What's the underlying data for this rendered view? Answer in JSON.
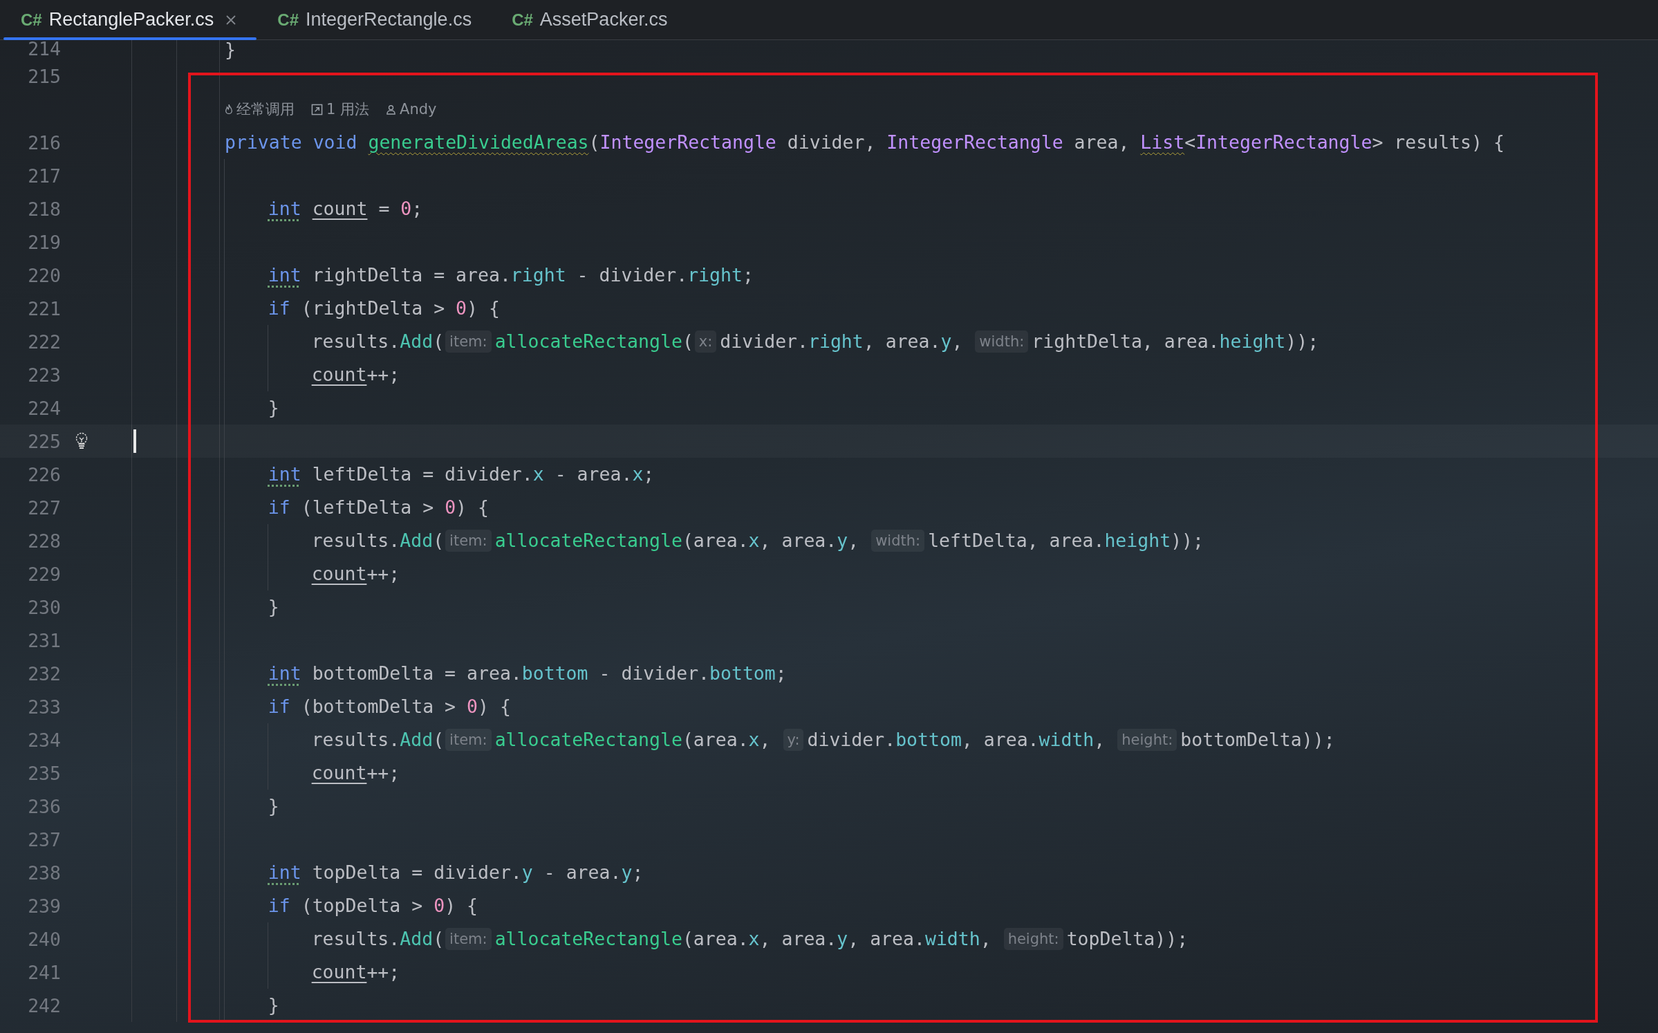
{
  "tabs": [
    {
      "badge": "C#",
      "label": "RectanglePacker.cs",
      "selected": true,
      "closable": true
    },
    {
      "badge": "C#",
      "label": "IntegerRectangle.cs",
      "selected": false,
      "closable": false
    },
    {
      "badge": "C#",
      "label": "AssetPacker.cs",
      "selected": false,
      "closable": false
    }
  ],
  "code_lens": [
    {
      "text": "经常调用"
    },
    {
      "text": "1 用法"
    },
    {
      "text": "Andy"
    }
  ],
  "lines": [
    {
      "number": "214",
      "tokens": [
        {
          "text": "}",
          "kind": "plain"
        }
      ]
    },
    {
      "number": "215"
    },
    {
      "kind": "code_lens"
    },
    {
      "number": "216",
      "tokens": [
        {
          "text": "private",
          "kind": "keyword"
        },
        {
          "text": " void",
          "kind": "keyword"
        },
        {
          "text": " generateDividedAreas",
          "kind": "function",
          "typo": true
        },
        {
          "text": "(",
          "kind": "plain"
        },
        {
          "text": "IntegerRectangle",
          "kind": "type"
        },
        {
          "text": " divider, ",
          "kind": "plain"
        },
        {
          "text": "IntegerRectangle",
          "kind": "type"
        },
        {
          "text": " area, ",
          "kind": "plain"
        },
        {
          "text": "List",
          "kind": "type",
          "typo": true
        },
        {
          "text": "<",
          "kind": "plain"
        },
        {
          "text": "IntegerRectangle",
          "kind": "type"
        },
        {
          "text": "> results) {",
          "kind": "plain"
        }
      ]
    },
    {
      "number": "217"
    },
    {
      "number": "218",
      "tokens": [
        {
          "text": "    int",
          "kind": "keyword",
          "weak_warning": true
        },
        {
          "text": " count",
          "kind": "plain",
          "mutable": true
        },
        {
          "text": " = ",
          "kind": "plain"
        },
        {
          "text": "0",
          "kind": "number"
        },
        {
          "text": ";",
          "kind": "plain"
        }
      ]
    },
    {
      "number": "219"
    },
    {
      "number": "220",
      "tokens": [
        {
          "text": "    int",
          "kind": "keyword",
          "weak_warning": true
        },
        {
          "text": " rightDelta = area.",
          "kind": "plain"
        },
        {
          "text": "right",
          "kind": "field"
        },
        {
          "text": " - divider.",
          "kind": "plain"
        },
        {
          "text": "right",
          "kind": "field"
        },
        {
          "text": ";",
          "kind": "plain"
        }
      ]
    },
    {
      "number": "221",
      "tokens": [
        {
          "text": "    if",
          "kind": "keyword"
        },
        {
          "text": " (rightDelta > ",
          "kind": "plain"
        },
        {
          "text": "0",
          "kind": "number"
        },
        {
          "text": ") {",
          "kind": "plain"
        }
      ]
    },
    {
      "number": "222",
      "tokens": [
        {
          "text": "        results.",
          "kind": "plain"
        },
        {
          "text": "Add",
          "kind": "method"
        },
        {
          "text": "(",
          "kind": "plain"
        },
        {
          "text": "item:",
          "kind": "hint"
        },
        {
          "text": "allocateRectangle",
          "kind": "function"
        },
        {
          "text": "(",
          "kind": "plain"
        },
        {
          "text": "x:",
          "kind": "hint"
        },
        {
          "text": "divider.",
          "kind": "plain"
        },
        {
          "text": "right",
          "kind": "field"
        },
        {
          "text": ", area.",
          "kind": "plain"
        },
        {
          "text": "y",
          "kind": "field"
        },
        {
          "text": ", ",
          "kind": "plain"
        },
        {
          "text": "width:",
          "kind": "hint"
        },
        {
          "text": "rightDelta, area.",
          "kind": "plain"
        },
        {
          "text": "height",
          "kind": "field"
        },
        {
          "text": "));",
          "kind": "plain"
        }
      ]
    },
    {
      "number": "223",
      "tokens": [
        {
          "text": "        count",
          "kind": "plain",
          "mutable": true
        },
        {
          "text": "++;",
          "kind": "plain"
        }
      ]
    },
    {
      "number": "224",
      "tokens": [
        {
          "text": "    }",
          "kind": "plain"
        }
      ]
    },
    {
      "number": "225",
      "current": true,
      "intention": true
    },
    {
      "number": "226",
      "tokens": [
        {
          "text": "    int",
          "kind": "keyword",
          "weak_warning": true
        },
        {
          "text": " leftDelta = divider.",
          "kind": "plain"
        },
        {
          "text": "x",
          "kind": "field"
        },
        {
          "text": " - area.",
          "kind": "plain"
        },
        {
          "text": "x",
          "kind": "field"
        },
        {
          "text": ";",
          "kind": "plain"
        }
      ]
    },
    {
      "number": "227",
      "tokens": [
        {
          "text": "    if",
          "kind": "keyword"
        },
        {
          "text": " (leftDelta > ",
          "kind": "plain"
        },
        {
          "text": "0",
          "kind": "number"
        },
        {
          "text": ") {",
          "kind": "plain"
        }
      ]
    },
    {
      "number": "228",
      "tokens": [
        {
          "text": "        results.",
          "kind": "plain"
        },
        {
          "text": "Add",
          "kind": "method"
        },
        {
          "text": "(",
          "kind": "plain"
        },
        {
          "text": "item:",
          "kind": "hint"
        },
        {
          "text": "allocateRectangle",
          "kind": "function"
        },
        {
          "text": "(area.",
          "kind": "plain"
        },
        {
          "text": "x",
          "kind": "field"
        },
        {
          "text": ", area.",
          "kind": "plain"
        },
        {
          "text": "y",
          "kind": "field"
        },
        {
          "text": ", ",
          "kind": "plain"
        },
        {
          "text": "width:",
          "kind": "hint"
        },
        {
          "text": "leftDelta, area.",
          "kind": "plain"
        },
        {
          "text": "height",
          "kind": "field"
        },
        {
          "text": "));",
          "kind": "plain"
        }
      ]
    },
    {
      "number": "229",
      "tokens": [
        {
          "text": "        count",
          "kind": "plain",
          "mutable": true
        },
        {
          "text": "++;",
          "kind": "plain"
        }
      ]
    },
    {
      "number": "230",
      "tokens": [
        {
          "text": "    }",
          "kind": "plain"
        }
      ]
    },
    {
      "number": "231"
    },
    {
      "number": "232",
      "tokens": [
        {
          "text": "    int",
          "kind": "keyword",
          "weak_warning": true
        },
        {
          "text": " bottomDelta = area.",
          "kind": "plain"
        },
        {
          "text": "bottom",
          "kind": "field"
        },
        {
          "text": " - divider.",
          "kind": "plain"
        },
        {
          "text": "bottom",
          "kind": "field"
        },
        {
          "text": ";",
          "kind": "plain"
        }
      ]
    },
    {
      "number": "233",
      "tokens": [
        {
          "text": "    if",
          "kind": "keyword"
        },
        {
          "text": " (bottomDelta > ",
          "kind": "plain"
        },
        {
          "text": "0",
          "kind": "number"
        },
        {
          "text": ") {",
          "kind": "plain"
        }
      ]
    },
    {
      "number": "234",
      "tokens": [
        {
          "text": "        results.",
          "kind": "plain"
        },
        {
          "text": "Add",
          "kind": "method"
        },
        {
          "text": "(",
          "kind": "plain"
        },
        {
          "text": "item:",
          "kind": "hint"
        },
        {
          "text": "allocateRectangle",
          "kind": "function"
        },
        {
          "text": "(area.",
          "kind": "plain"
        },
        {
          "text": "x",
          "kind": "field"
        },
        {
          "text": ", ",
          "kind": "plain"
        },
        {
          "text": "y:",
          "kind": "hint"
        },
        {
          "text": "divider.",
          "kind": "plain"
        },
        {
          "text": "bottom",
          "kind": "field"
        },
        {
          "text": ", area.",
          "kind": "plain"
        },
        {
          "text": "width",
          "kind": "field"
        },
        {
          "text": ", ",
          "kind": "plain"
        },
        {
          "text": "height:",
          "kind": "hint"
        },
        {
          "text": "bottomDelta));",
          "kind": "plain"
        }
      ]
    },
    {
      "number": "235",
      "tokens": [
        {
          "text": "        count",
          "kind": "plain",
          "mutable": true
        },
        {
          "text": "++;",
          "kind": "plain"
        }
      ]
    },
    {
      "number": "236",
      "tokens": [
        {
          "text": "    }",
          "kind": "plain"
        }
      ]
    },
    {
      "number": "237"
    },
    {
      "number": "238",
      "tokens": [
        {
          "text": "    int",
          "kind": "keyword",
          "weak_warning": true
        },
        {
          "text": " topDelta = divider.",
          "kind": "plain"
        },
        {
          "text": "y",
          "kind": "field"
        },
        {
          "text": " - area.",
          "kind": "plain"
        },
        {
          "text": "y",
          "kind": "field"
        },
        {
          "text": ";",
          "kind": "plain"
        }
      ]
    },
    {
      "number": "239",
      "tokens": [
        {
          "text": "    if",
          "kind": "keyword"
        },
        {
          "text": " (topDelta > ",
          "kind": "plain"
        },
        {
          "text": "0",
          "kind": "number"
        },
        {
          "text": ") {",
          "kind": "plain"
        }
      ]
    },
    {
      "number": "240",
      "tokens": [
        {
          "text": "        results.",
          "kind": "plain"
        },
        {
          "text": "Add",
          "kind": "method"
        },
        {
          "text": "(",
          "kind": "plain"
        },
        {
          "text": "item:",
          "kind": "hint"
        },
        {
          "text": "allocateRectangle",
          "kind": "function"
        },
        {
          "text": "(area.",
          "kind": "plain"
        },
        {
          "text": "x",
          "kind": "field"
        },
        {
          "text": ", area.",
          "kind": "plain"
        },
        {
          "text": "y",
          "kind": "field"
        },
        {
          "text": ", area.",
          "kind": "plain"
        },
        {
          "text": "width",
          "kind": "field"
        },
        {
          "text": ", ",
          "kind": "plain"
        },
        {
          "text": "height:",
          "kind": "hint"
        },
        {
          "text": "topDelta));",
          "kind": "plain"
        }
      ]
    },
    {
      "number": "241",
      "tokens": [
        {
          "text": "        count",
          "kind": "plain",
          "mutable": true
        },
        {
          "text": "++;",
          "kind": "plain"
        }
      ]
    },
    {
      "number": "242",
      "tokens": [
        {
          "text": "    }",
          "kind": "plain"
        }
      ]
    }
  ]
}
